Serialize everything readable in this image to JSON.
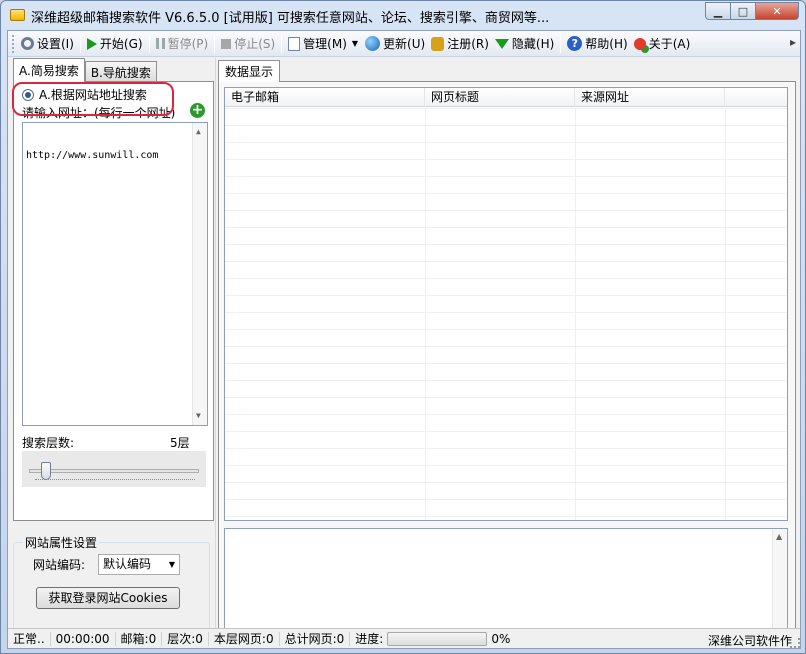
{
  "window": {
    "title": "深维超级邮箱搜索软件 V6.6.5.0 [试用版] 可搜索任意网站、论坛、搜索引擎、商贸网等..."
  },
  "toolbar": {
    "items": [
      {
        "label": "设置(I)",
        "icon": "gear-icon"
      },
      {
        "label": "开始(G)",
        "icon": "play-icon"
      },
      {
        "label": "暂停(P)",
        "icon": "pause-icon"
      },
      {
        "label": "停止(S)",
        "icon": "stop-icon"
      },
      {
        "label": "管理(M)",
        "icon": "document-icon"
      },
      {
        "label": "更新(U)",
        "icon": "globe-icon"
      },
      {
        "label": "注册(R)",
        "icon": "key-icon"
      },
      {
        "label": "隐藏(H)",
        "icon": "download-arrow-icon"
      },
      {
        "label": "帮助(H)",
        "icon": "help-icon"
      },
      {
        "label": "关于(A)",
        "icon": "about-icon"
      }
    ]
  },
  "left": {
    "tabs": [
      "A.简易搜索",
      "B.导航搜索"
    ],
    "radio_label": "A.根据网站地址搜索",
    "prompt": "请输入网址：(每行一个网址)",
    "url_input_value": "http://www.sunwill.com",
    "depth_label": "搜索层数:",
    "depth_value": "5层",
    "depth_level": 5
  },
  "properties": {
    "legend": "网站属性设置",
    "encoding_label": "网站编码:",
    "encoding_value": "默认编码",
    "cookie_button": "获取登录网站Cookies"
  },
  "right": {
    "tab": "数据显示",
    "columns": [
      "电子邮箱",
      "网页标题",
      "来源网址"
    ]
  },
  "status": {
    "state": "正常..",
    "time": "00:00:00",
    "mailbox": "邮箱:0",
    "level": "层次:0",
    "layer_pages": "本层网页:0",
    "total_pages": "总计网页:0",
    "progress_label": "进度:",
    "progress_value": 0,
    "progress_text": "0%",
    "company": "深维公司软件作"
  },
  "colors": {
    "highlight": "#d8283c",
    "progress": "#3db43d"
  }
}
